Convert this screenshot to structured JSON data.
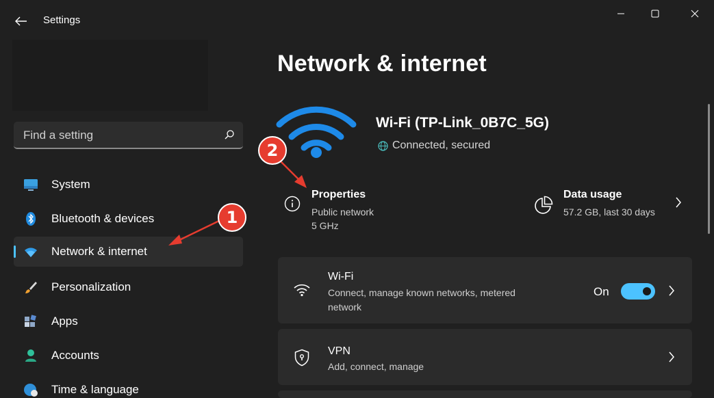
{
  "window": {
    "title": "Settings",
    "back_icon": "arrow-left-icon",
    "minimize_icon": "minimize-icon",
    "maximize_icon": "maximize-icon",
    "close_icon": "close-icon"
  },
  "search": {
    "placeholder": "Find a setting",
    "icon": "search-icon"
  },
  "sidebar": {
    "items": [
      {
        "label": "System",
        "icon": "monitor-icon",
        "active": false
      },
      {
        "label": "Bluetooth & devices",
        "icon": "bluetooth-icon",
        "active": false
      },
      {
        "label": "Network & internet",
        "icon": "wifi-icon",
        "active": true
      },
      {
        "label": "Personalization",
        "icon": "brush-icon",
        "active": false
      },
      {
        "label": "Apps",
        "icon": "apps-icon",
        "active": false
      },
      {
        "label": "Accounts",
        "icon": "person-icon",
        "active": false
      },
      {
        "label": "Time & language",
        "icon": "globe-clock-icon",
        "active": false
      }
    ]
  },
  "main": {
    "page_title": "Network & internet",
    "network": {
      "name": "Wi-Fi (TP-Link_0B7C_5G)",
      "status": "Connected, secured",
      "hero_icon": "wifi-large-icon",
      "status_icon": "globe-icon"
    },
    "properties": {
      "title": "Properties",
      "line1": "Public network",
      "line2": "5 GHz",
      "icon": "info-icon"
    },
    "data_usage": {
      "title": "Data usage",
      "subtitle": "57.2 GB, last 30 days",
      "icon": "pie-chart-icon"
    },
    "cards": [
      {
        "title": "Wi-Fi",
        "subtitle": "Connect, manage known networks, metered network",
        "icon": "wifi-icon",
        "toggle_label": "On",
        "toggle_on": true
      },
      {
        "title": "VPN",
        "subtitle": "Add, connect, manage",
        "icon": "shield-lock-icon"
      }
    ]
  },
  "annotations": [
    {
      "number": "1",
      "color": "#e63c2f"
    },
    {
      "number": "2",
      "color": "#e63c2f"
    }
  ],
  "colors": {
    "accent": "#4cc2ff",
    "background": "#202020",
    "card": "#2b2b2b",
    "annotation": "#e63c2f"
  }
}
